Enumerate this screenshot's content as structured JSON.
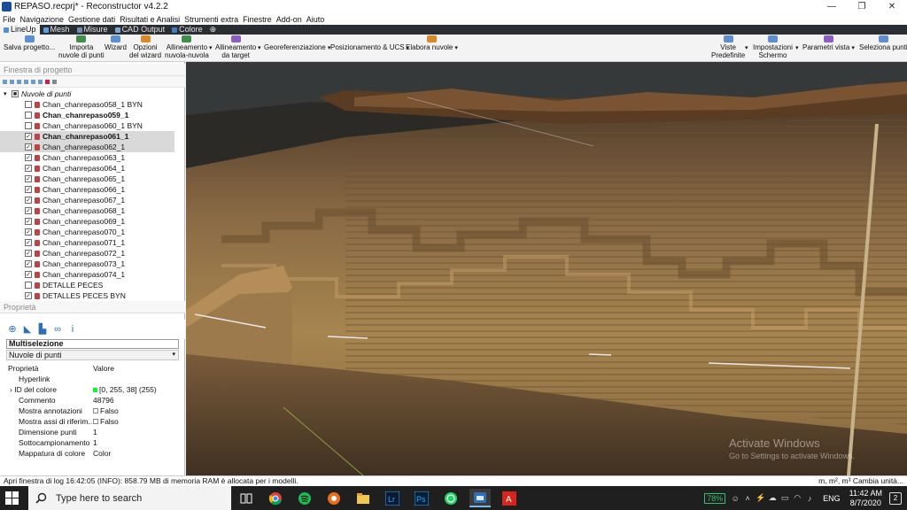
{
  "window": {
    "title": "REPASO.recprj* - Reconstructor v4.2.2",
    "controls": [
      "—",
      "❐",
      "✕"
    ]
  },
  "menu": [
    "File",
    "Navigazione",
    "Gestione dati",
    "Risultati e Analisi",
    "Strumenti extra",
    "Finestre",
    "Add-on",
    "Aiuto"
  ],
  "ribbon_tabs": [
    {
      "label": "LineUp",
      "active": true,
      "color": "#4a90d9"
    },
    {
      "label": "Mesh",
      "active": false,
      "color": "#5aa0e6"
    },
    {
      "label": "Misure",
      "active": false,
      "color": "#6b8fb5"
    },
    {
      "label": "CAD Output",
      "active": false,
      "color": "#7aa7d8"
    },
    {
      "label": "Colore",
      "active": false,
      "color": "#3c7dc4"
    },
    {
      "label": "⊕",
      "active": false,
      "color": ""
    }
  ],
  "ribbon": {
    "buttons": [
      {
        "label": "Salva progetto...",
        "line2": "",
        "icon": "save-icon",
        "caret": false
      },
      {
        "label": "Importa",
        "line2": "nuvole di punti",
        "icon": "import-icon",
        "caret": false
      },
      {
        "label": "Wizard",
        "line2": "",
        "icon": "wizard-icon",
        "caret": false
      },
      {
        "label": "Opzioni",
        "line2": "del wizard",
        "icon": "options-icon",
        "caret": false
      },
      {
        "label": "Allineamento",
        "line2": "nuvola-nuvola",
        "icon": "align-icon",
        "caret": true
      },
      {
        "label": "Allineamento",
        "line2": "da target",
        "icon": "target-icon",
        "caret": true
      },
      {
        "label": "Georeferenziazione",
        "line2": "",
        "icon": "",
        "caret": true
      },
      {
        "label": "Posizionamento & UCS",
        "line2": "",
        "icon": "",
        "caret": true
      },
      {
        "label": "Elabora nuvole",
        "line2": "",
        "icon": "process-icon",
        "caret": true
      },
      {
        "label": "Viste",
        "line2": "Predefinite",
        "icon": "views-icon",
        "caret": true
      },
      {
        "label": "Impostazioni",
        "line2": "Schermo",
        "icon": "monitor-icon",
        "caret": true
      },
      {
        "label": "Parametri vista",
        "line2": "",
        "icon": "params-icon",
        "caret": true
      },
      {
        "label": "Seleziona punti",
        "line2": "",
        "icon": "select-icon",
        "caret": false
      }
    ]
  },
  "project_panel": {
    "header": "Finestra di progetto",
    "root": {
      "label": "Nuvole di punti",
      "checked": true
    },
    "items": [
      {
        "label": "Chan_chanrepaso058_1 BYN",
        "checked": false,
        "bold": false,
        "selected": false
      },
      {
        "label": "Chan_chanrepaso059_1",
        "checked": false,
        "bold": true,
        "selected": false
      },
      {
        "label": "Chan_chanrepaso060_1 BYN",
        "checked": false,
        "bold": false,
        "selected": false
      },
      {
        "label": "Chan_chanrepaso061_1",
        "checked": true,
        "bold": true,
        "selected": true
      },
      {
        "label": "Chan_chanrepaso062_1",
        "checked": true,
        "bold": false,
        "selected": true
      },
      {
        "label": "Chan_chanrepaso063_1",
        "checked": true,
        "bold": false,
        "selected": false
      },
      {
        "label": "Chan_chanrepaso064_1",
        "checked": true,
        "bold": false,
        "selected": false
      },
      {
        "label": "Chan_chanrepaso065_1",
        "checked": true,
        "bold": false,
        "selected": false
      },
      {
        "label": "Chan_chanrepaso066_1",
        "checked": true,
        "bold": false,
        "selected": false
      },
      {
        "label": "Chan_chanrepaso067_1",
        "checked": true,
        "bold": false,
        "selected": false
      },
      {
        "label": "Chan_chanrepaso068_1",
        "checked": true,
        "bold": false,
        "selected": false
      },
      {
        "label": "Chan_chanrepaso069_1",
        "checked": true,
        "bold": false,
        "selected": false
      },
      {
        "label": "Chan_chanrepaso070_1",
        "checked": true,
        "bold": false,
        "selected": false
      },
      {
        "label": "Chan_chanrepaso071_1",
        "checked": true,
        "bold": false,
        "selected": false
      },
      {
        "label": "Chan_chanrepaso072_1",
        "checked": true,
        "bold": false,
        "selected": false
      },
      {
        "label": "Chan_chanrepaso073_1",
        "checked": true,
        "bold": false,
        "selected": false
      },
      {
        "label": "Chan_chanrepaso074_1",
        "checked": true,
        "bold": false,
        "selected": false
      },
      {
        "label": "DETALLE PECES",
        "checked": false,
        "bold": false,
        "selected": false
      },
      {
        "label": "DETALLES PECES BYN",
        "checked": true,
        "bold": false,
        "selected": false
      }
    ]
  },
  "properties_panel": {
    "header": "Proprietà",
    "multiselection": "Multiselezione",
    "type_select": "Nuvole di punti",
    "columns": {
      "key": "Proprietà",
      "value": "Valore"
    },
    "rows": [
      {
        "key": "Hyperlink",
        "value": "",
        "swatch": "",
        "checkbox": false,
        "expand": false
      },
      {
        "key": "ID del colore",
        "value": "[0, 255, 38] (255)",
        "swatch": "#00ff26",
        "checkbox": false,
        "expand": true
      },
      {
        "key": "Commento",
        "value": "48796",
        "swatch": "",
        "checkbox": false,
        "expand": false
      },
      {
        "key": "Mostra annotazioni",
        "value": "Falso",
        "swatch": "",
        "checkbox": true,
        "expand": false
      },
      {
        "key": "Mostra assi di riferim...",
        "value": "Falso",
        "swatch": "",
        "checkbox": true,
        "expand": false
      },
      {
        "key": "Dimensione punti",
        "value": "1",
        "swatch": "",
        "checkbox": false,
        "expand": false
      },
      {
        "key": "Sottocampionamento",
        "value": "1",
        "swatch": "",
        "checkbox": false,
        "expand": false
      },
      {
        "key": "Mappatura di colore",
        "value": "Color",
        "swatch": "",
        "checkbox": false,
        "expand": false
      }
    ]
  },
  "watermark": {
    "title": "Activate Windows",
    "sub": "Go to Settings to activate Windows."
  },
  "statusbar": {
    "left": "Apri finestra di log   16:42:05 (INFO): 858.79 MB di memoria RAM è allocata per i modelli.",
    "right": "m, m², m³  Cambia unità..."
  },
  "taskbar": {
    "search_placeholder": "Type here to search",
    "battery": "78%",
    "language": "ENG",
    "time": "11:42 AM",
    "date": "8/7/2020",
    "notifications": "2"
  }
}
